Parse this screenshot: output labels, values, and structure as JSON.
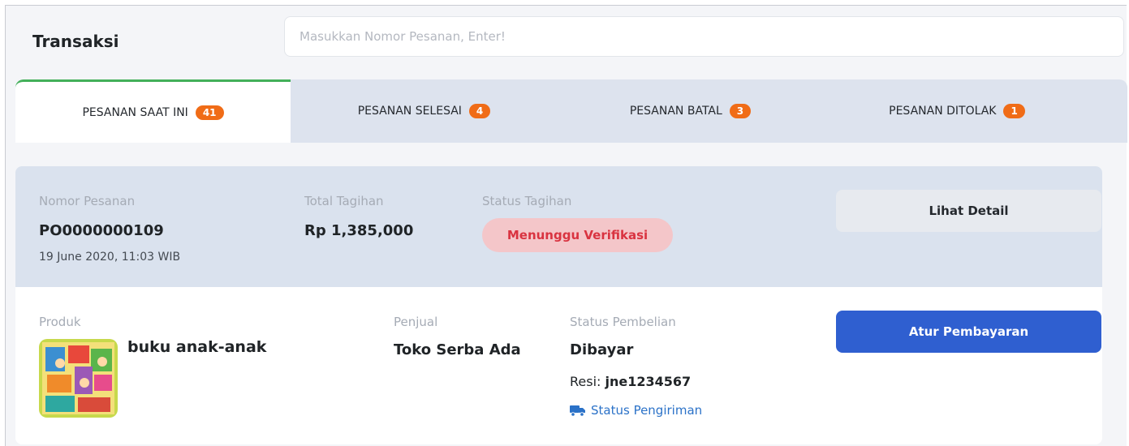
{
  "page": {
    "title": "Transaksi"
  },
  "search": {
    "placeholder": "Masukkan Nomor Pesanan, Enter!"
  },
  "tabs": [
    {
      "label": "PESANAN SAAT INI",
      "count": "41",
      "active": true
    },
    {
      "label": "PESANAN SELESAI",
      "count": "4",
      "active": false
    },
    {
      "label": "PESANAN BATAL",
      "count": "3",
      "active": false
    },
    {
      "label": "PESANAN DITOLAK",
      "count": "1",
      "active": false
    }
  ],
  "order": {
    "number_label": "Nomor Pesanan",
    "number": "PO0000000109",
    "date": "19 June 2020, 11:03 WIB",
    "total_label": "Total Tagihan",
    "total": "Rp 1,385,000",
    "bill_status_label": "Status Tagihan",
    "bill_status": "Menunggu Verifikasi",
    "detail_button": "Lihat Detail",
    "product_label": "Produk",
    "product_name": "buku anak-anak",
    "seller_label": "Penjual",
    "seller": "Toko Serba Ada",
    "purchase_status_label": "Status Pembelian",
    "purchase_status": "Dibayar",
    "resi_label": "Resi:",
    "resi": "jne1234567",
    "shipping_link": "Status Pengiriman",
    "pay_button": "Atur Pembayaran"
  },
  "colors": {
    "accent_tab": "#43b05a",
    "badge": "#f06c17",
    "primary_button": "#2f5fd0",
    "status_pending_bg": "#f4c6c9",
    "status_pending_text": "#d93340",
    "link": "#2b72c8"
  },
  "icons": {
    "shipping": "truck-icon"
  }
}
